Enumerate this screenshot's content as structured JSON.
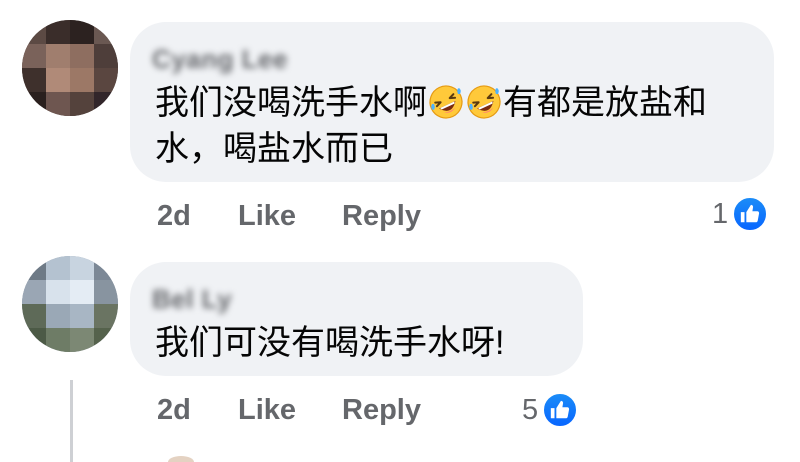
{
  "comments": [
    {
      "author": "Cyang Lee",
      "text_part1": "我们没喝洗手水啊",
      "emoji": [
        "rolling-on-floor-laughing-emoji",
        "rolling-on-floor-laughing-emoji"
      ],
      "text_part2": "有都是放盐和",
      "text_line2": "水，喝盐水而已",
      "time": "2d",
      "like_label": "Like",
      "reply_label": "Reply",
      "reaction_count": "1",
      "reaction_icon": "like-thumb-icon"
    },
    {
      "author": "Bel Ly",
      "text": "我们可没有喝洗手水呀!",
      "time": "2d",
      "like_label": "Like",
      "reply_label": "Reply",
      "reaction_count": "5",
      "reaction_icon": "like-thumb-icon"
    }
  ],
  "colors": {
    "bubble": "#f0f2f5",
    "meta_text": "#65676b",
    "like_blue": "#0866ff",
    "thread_line": "#ced0d4"
  }
}
